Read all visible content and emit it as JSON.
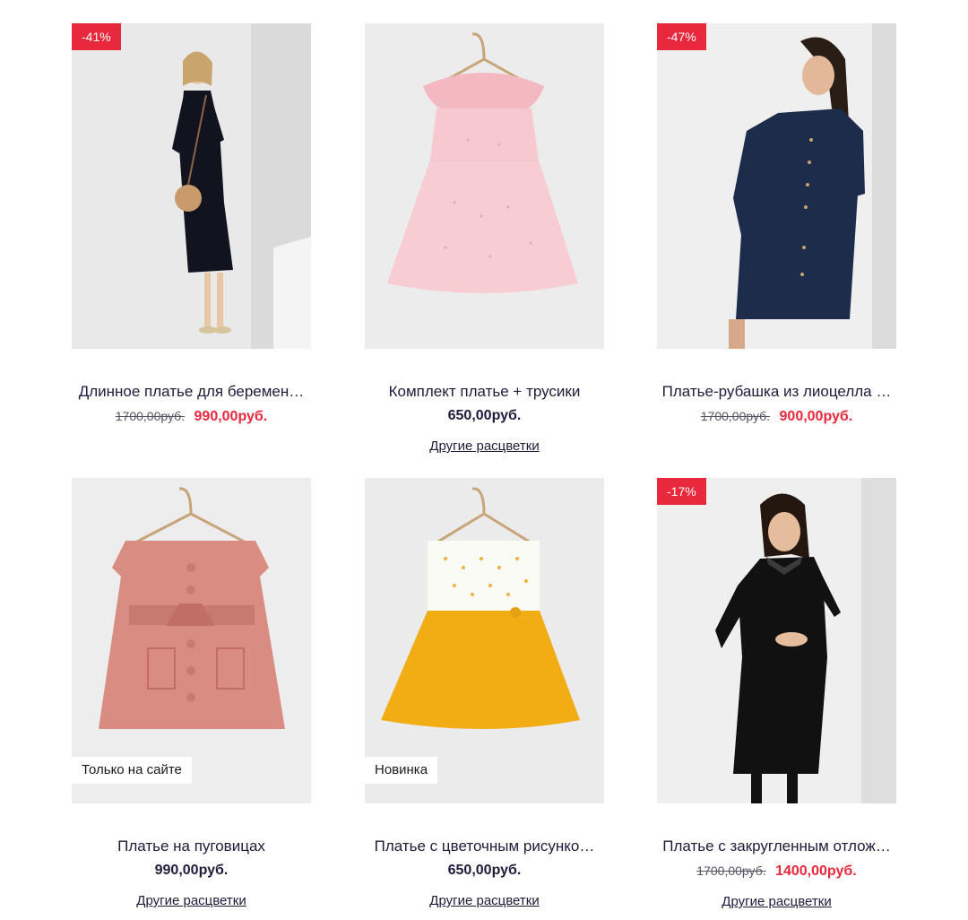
{
  "products": [
    {
      "title": "Длинное платье для беремен…",
      "discount": "-41%",
      "old_price": "1700,00руб.",
      "price": "990,00руб.",
      "image_icon": "black-maternity-dress-photo"
    },
    {
      "title": "Комплект платье + трусики",
      "price": "650,00руб.",
      "colors_link": "Другие расцветки",
      "image_icon": "pink-girl-dress-photo"
    },
    {
      "title": "Платье-рубашка из лиоцелла …",
      "discount": "-47%",
      "old_price": "1700,00руб.",
      "price": "900,00руб.",
      "image_icon": "navy-shirt-dress-photo"
    },
    {
      "title": "Платье на пуговицах",
      "price": "990,00руб.",
      "label": "Только на сайте",
      "colors_link": "Другие расцветки",
      "image_icon": "rose-button-dress-photo"
    },
    {
      "title": "Платье с цветочным рисунко…",
      "price": "650,00руб.",
      "label": "Новинка",
      "colors_link": "Другие расцветки",
      "image_icon": "yellow-white-dress-photo"
    },
    {
      "title": "Платье с закругленным отлож…",
      "discount": "-17%",
      "old_price": "1700,00руб.",
      "price": "1400,00руб.",
      "colors_link": "Другие расцветки",
      "image_icon": "black-collar-dress-photo"
    }
  ],
  "colors": {
    "sale_red": "#e8283c",
    "text_navy": "#1c1c3c",
    "image_bg": "#ececec"
  }
}
